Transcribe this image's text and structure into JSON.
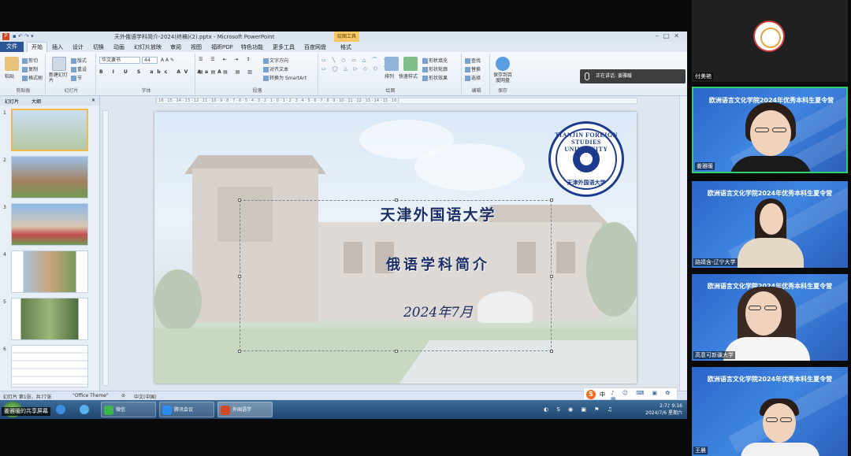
{
  "window": {
    "title": "天外俄语学科简介-2024(终稿)(2).pptx - Microsoft PowerPoint",
    "context_tab": "绘图工具"
  },
  "menu_tabs": [
    "文件",
    "开始",
    "插入",
    "设计",
    "切换",
    "动画",
    "幻灯片放映",
    "审阅",
    "视图",
    "福昕PDF",
    "特色功能",
    "更多工具",
    "百度网盘",
    "格式"
  ],
  "ribbon": {
    "clipboard": {
      "label": "剪贴板",
      "cut": "剪切",
      "copy": "复制",
      "paste": "粘贴",
      "format_painter": "格式刷"
    },
    "slides": {
      "label": "幻灯片",
      "new_slide": "新建幻灯片",
      "layout": "版式",
      "reset": "重设",
      "section": "节"
    },
    "font": {
      "label": "字体",
      "name": "华文隶书",
      "size": "44"
    },
    "paragraph": {
      "label": "段落",
      "text_direction": "文字方向",
      "align_text": "对齐文本",
      "smartart": "转换为 SmartArt"
    },
    "drawing": {
      "label": "绘图",
      "arrange": "排列",
      "quick_styles": "快速样式",
      "fill": "形状填充",
      "outline": "形状轮廓",
      "effects": "形状效果"
    },
    "editing": {
      "label": "编辑",
      "find": "查找",
      "replace": "替换",
      "select": "选择"
    },
    "save": {
      "label": "保存",
      "save_baidu": "保存到百度网盘"
    }
  },
  "speaking": {
    "label": "正在讲话:",
    "name": "姜雅暖"
  },
  "left_pane": {
    "tab_slides": "幻灯片",
    "tab_outline": "大纲",
    "thumbnails": [
      "1",
      "2",
      "3",
      "4",
      "5",
      "6"
    ]
  },
  "slide": {
    "title": "天津外国语大学",
    "subtitle": "俄语学科简介",
    "date": "2024年7月",
    "logo_text": "TIANJIN FOREIGN STUDIES UNIVERSITY",
    "logo_cn": "天津外国语大学"
  },
  "statusbar": {
    "slide_info": "幻灯片 第1张，共77张",
    "theme": "\"Office Theme\"",
    "lang": "中文(中国)"
  },
  "ime": {
    "label": "中"
  },
  "taskbar": {
    "items": [
      "微信",
      "腾讯会议",
      "外国语学"
    ],
    "sharer": "姜雅暖的共享屏幕",
    "time": "2:7♪ 9:16",
    "date": "2024/7/6 星期六"
  },
  "participants": [
    {
      "name": "付美艳",
      "banner": "",
      "camera": false
    },
    {
      "name": "姜雅暖",
      "banner": "欧洲语言文化学院2024年优秀本科生夏令营",
      "camera": true,
      "speaking": true
    },
    {
      "name": "路婧含-辽宁大学",
      "banner": "欧洲语言文化学院2024年优秀本科生夏令营",
      "camera": true
    },
    {
      "name": "高意可新疆大学",
      "banner": "欧洲语言文化学院2024年优秀本科生夏令营",
      "camera": true
    },
    {
      "name": "王晨",
      "banner": "欧洲语言文化学院2024年优秀本科生夏令营",
      "camera": true
    }
  ],
  "colors": {
    "accent": "#2b5797",
    "slide_text": "#1b2f66",
    "active_speaker": "#2fcf6a",
    "banner_bg": "#2a66c8"
  }
}
